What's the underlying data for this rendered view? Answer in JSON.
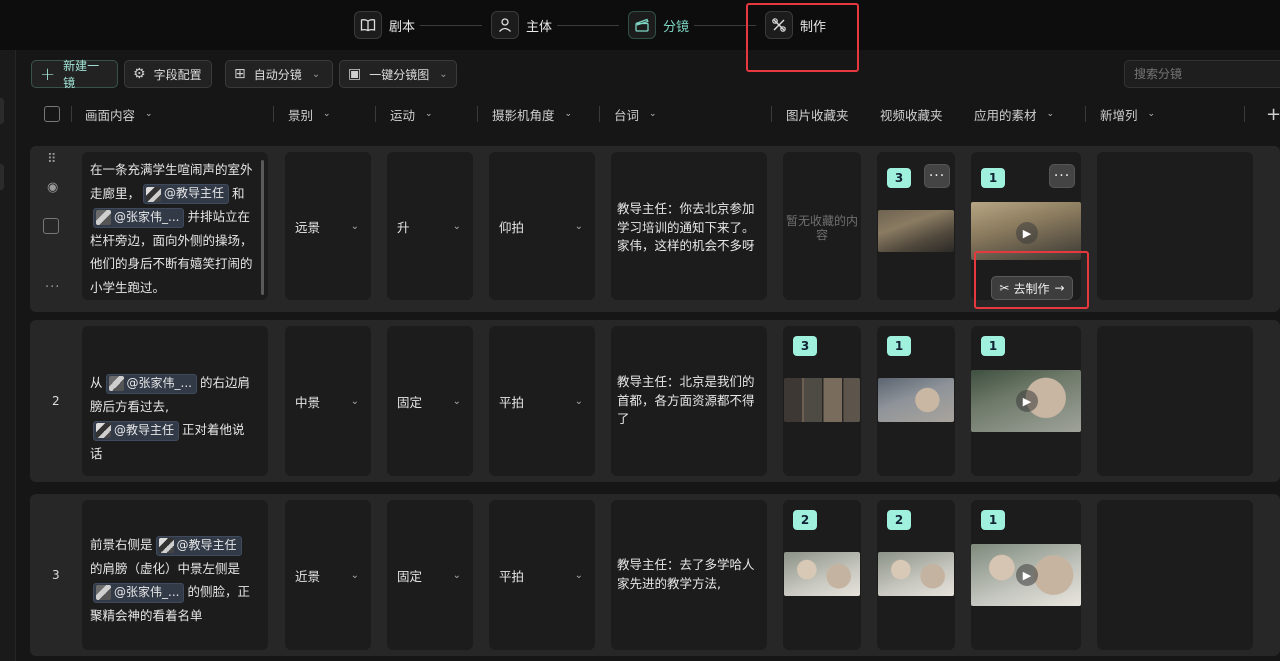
{
  "stepper": {
    "steps": [
      {
        "label": "剧本",
        "icon": "book-icon",
        "state": "normal"
      },
      {
        "label": "主体",
        "icon": "user-icon",
        "state": "normal"
      },
      {
        "label": "分镜",
        "icon": "clapper-icon",
        "state": "active"
      },
      {
        "label": "制作",
        "icon": "scissors-tool-icon",
        "state": "highlighted"
      }
    ]
  },
  "toolbar": {
    "new_shot": "新建一镜",
    "field_config": "字段配置",
    "auto_split": "自动分镜",
    "one_click": "一键分镜图",
    "search_placeholder": "搜索分镜"
  },
  "columns": [
    "画面内容",
    "景别",
    "运动",
    "摄影机角度",
    "台词",
    "图片收藏夹",
    "视频收藏夹",
    "应用的素材",
    "新增列"
  ],
  "add_column": "+",
  "rows": [
    {
      "number": "",
      "content": {
        "p1": "在一条充满学生喧闹声的室外走廊里，",
        "tag1": "@教导主任",
        "p2": "和",
        "tag2": "@张家伟_...",
        "p3": "并排站立在栏杆旁边，面向外侧的操场，他们的身后不断有嬉笑打闹的小学生跑过。"
      },
      "shot_size": "远景",
      "motion": "升",
      "angle": "仰拍",
      "dialogue": "教导主任：你去北京参加学习培训的通知下来了。家伟，这样的机会不多呀",
      "image_fav": {
        "count": "",
        "empty_text": "暂无收藏的内容"
      },
      "video_fav": {
        "count": "3",
        "more": "···"
      },
      "applied": {
        "count": "1",
        "more": "···",
        "make_button": "去制作"
      }
    },
    {
      "number": "2",
      "content": {
        "p1": "从",
        "tag1": "@张家伟_...",
        "p2": "的右边肩膀后方看过去,",
        "tag2": "@教导主任",
        "p3": "正对着他说话"
      },
      "shot_size": "中景",
      "motion": "固定",
      "angle": "平拍",
      "dialogue": "教导主任：北京是我们的首都，各方面资源都不得了",
      "image_fav": {
        "count": "3"
      },
      "video_fav": {
        "count": "1"
      },
      "applied": {
        "count": "1"
      }
    },
    {
      "number": "3",
      "content": {
        "p1": "前景右侧是",
        "tag1": "@教导主任",
        "p2": "的肩膀（虚化）中景左侧是",
        "tag2": "@张家伟_...",
        "p3": "的侧脸，正聚精会神的看着名单"
      },
      "shot_size": "近景",
      "motion": "固定",
      "angle": "平拍",
      "dialogue": "教导主任：去了多学哈人家先进的教学方法,",
      "image_fav": {
        "count": "2"
      },
      "video_fav": {
        "count": "2"
      },
      "applied": {
        "count": "1"
      }
    }
  ],
  "colors": {
    "accent": "#9ff0dc",
    "highlight": "#e5393f",
    "tag_bg": "#323a48"
  }
}
